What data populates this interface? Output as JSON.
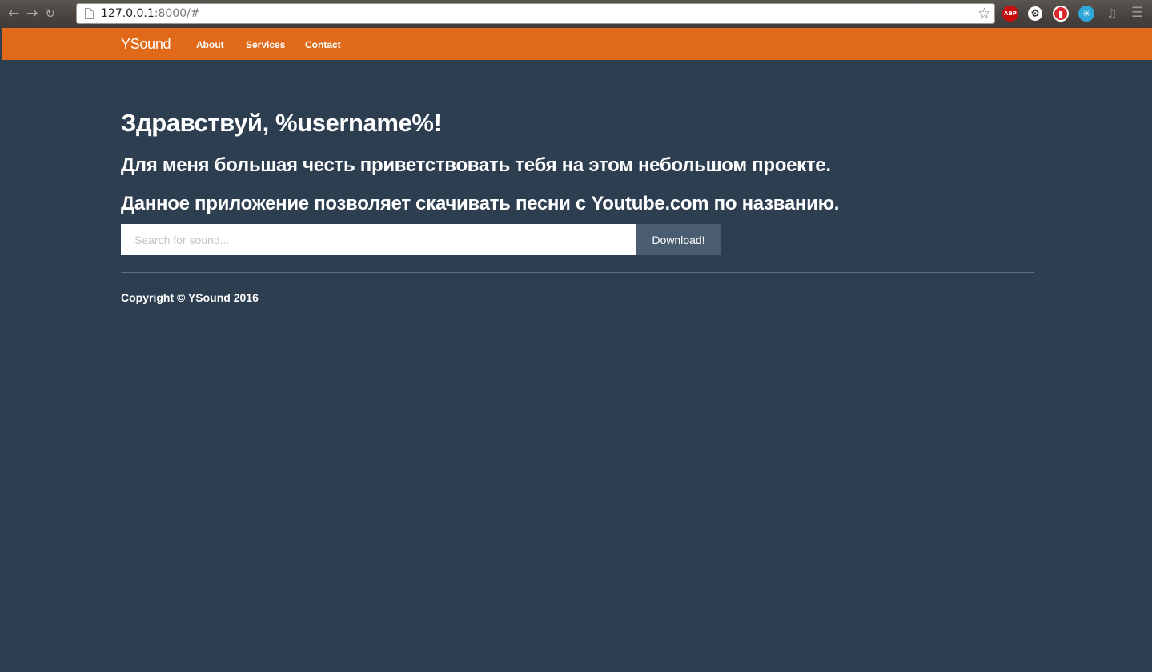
{
  "browser": {
    "url_host": "127.0.0.1",
    "url_rest": ":8000/#",
    "back_icon": "back-arrow-icon",
    "forward_icon": "forward-arrow-icon",
    "reload_icon": "reload-icon",
    "extensions": [
      {
        "name": "adblock-plus-icon",
        "label": "ABP"
      },
      {
        "name": "gear-extension-icon"
      },
      {
        "name": "red-extension-icon"
      },
      {
        "name": "blue-extension-icon"
      },
      {
        "name": "music-extension-icon"
      }
    ]
  },
  "navbar": {
    "brand": "YSound",
    "links": [
      "About",
      "Services",
      "Contact"
    ],
    "color": "#e0691a"
  },
  "main": {
    "greeting": "Здравствуй, %username%!",
    "line1": "Для меня большая честь приветствовать тебя на этом небольшом проекте.",
    "line2": "Данное приложение позволяет скачивать песни с Youtube.com по названию.",
    "search_placeholder": "Search for sound...",
    "search_value": "",
    "download_label": "Download!"
  },
  "footer": {
    "copyright": "Copyright © YSound 2016"
  },
  "colors": {
    "background": "#2c3e50",
    "button": "#4a5d70"
  }
}
